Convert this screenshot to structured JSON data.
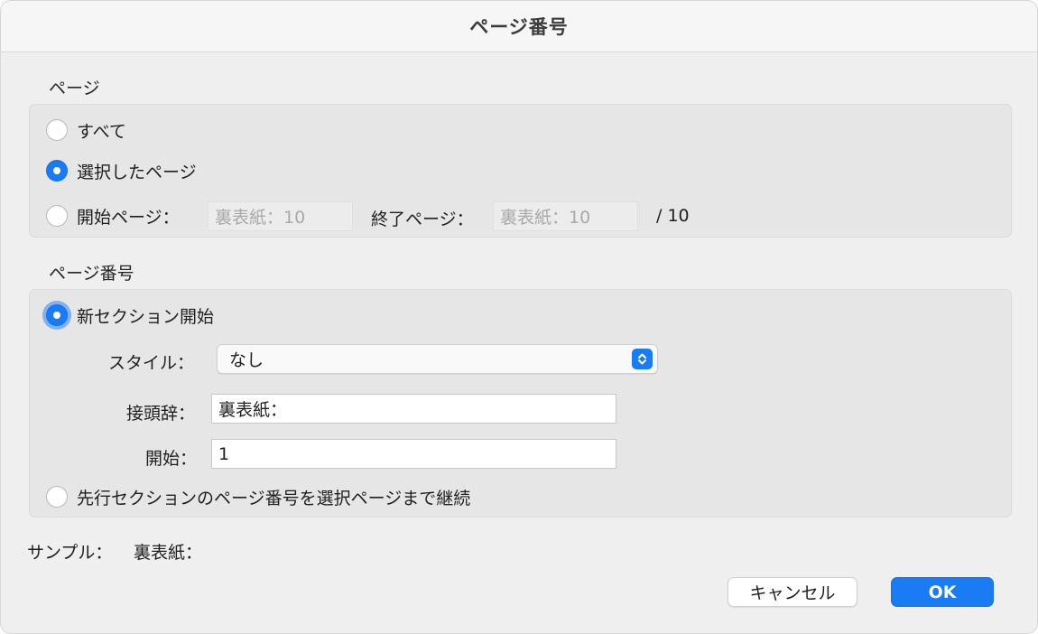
{
  "window": {
    "title": "ページ番号"
  },
  "page_section": {
    "label": "ページ",
    "options": {
      "all": "すべて",
      "selected": "選択したページ",
      "range": "開始ページ："
    },
    "range": {
      "start_value": "裏表紙：10",
      "end_label": "終了ページ：",
      "end_value": "裏表紙：10",
      "total": "/ 10"
    },
    "selected_option": "selected"
  },
  "numbering_section": {
    "label": "ページ番号",
    "options": {
      "new_section": "新セクション開始",
      "continue": "先行セクションのページ番号を選択ページまで継続"
    },
    "selected_option": "new_section",
    "style_label": "スタイル：",
    "style_value": "なし",
    "prefix_label": "接頭辞：",
    "prefix_value": "裏表紙：",
    "start_label": "開始：",
    "start_value": "1"
  },
  "sample": {
    "label": "サンプル：",
    "value": "裏表紙："
  },
  "buttons": {
    "cancel": "キャンセル",
    "ok": "OK"
  },
  "colors": {
    "accent": "#1a7cf5",
    "focus_ring": "#7fb2f4",
    "window_bg": "#efefef",
    "group_bg": "#e6e6e6"
  },
  "icons": {
    "select_arrow": "chevron-up-down-icon"
  }
}
